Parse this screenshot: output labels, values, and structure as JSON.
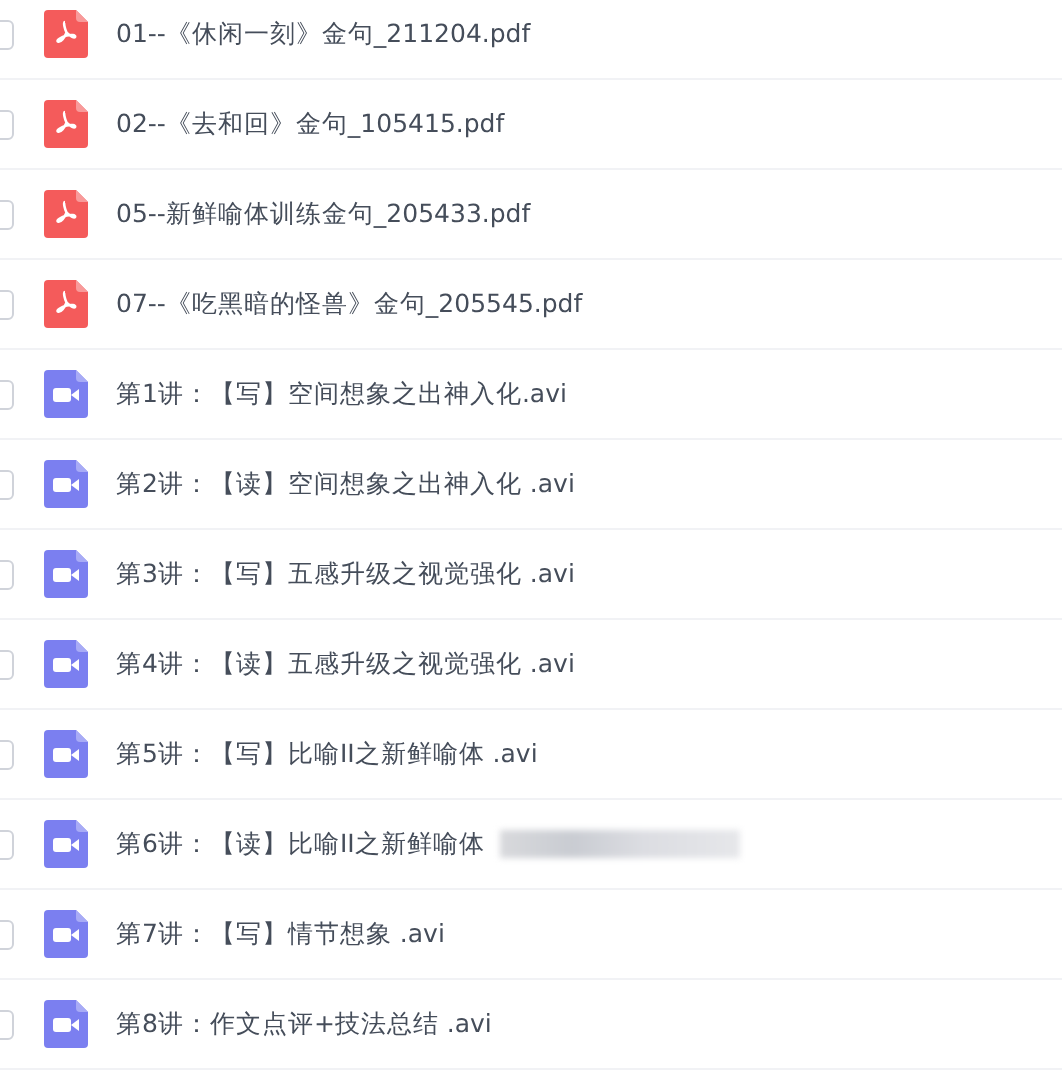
{
  "files": [
    {
      "kind": "pdf",
      "name": "01--《休闲一刻》金句_211204.pdf",
      "checked": false
    },
    {
      "kind": "pdf",
      "name": "02--《去和回》金句_105415.pdf",
      "checked": false
    },
    {
      "kind": "pdf",
      "name": "05--新鲜喻体训练金句_205433.pdf",
      "checked": false
    },
    {
      "kind": "pdf",
      "name": "07--《吃黑暗的怪兽》金句_205545.pdf",
      "checked": false
    },
    {
      "kind": "video",
      "name": "第1讲：【写】空间想象之出神入化.avi",
      "checked": false
    },
    {
      "kind": "video",
      "name": "第2讲：【读】空间想象之出神入化 .avi",
      "checked": false
    },
    {
      "kind": "video",
      "name": "第3讲：【写】五感升级之视觉强化 .avi",
      "checked": false
    },
    {
      "kind": "video",
      "name": "第4讲：【读】五感升级之视觉强化 .avi",
      "checked": false
    },
    {
      "kind": "video",
      "name": "第5讲：【写】比喻II之新鲜喻体 .avi",
      "checked": false
    },
    {
      "kind": "video",
      "name": "第6讲：【读】比喻II之新鲜喻体",
      "checked": false,
      "redacted": true
    },
    {
      "kind": "video",
      "name": "第7讲：【写】情节想象 .avi",
      "checked": false
    },
    {
      "kind": "video",
      "name": "第8讲：作文点评+技法总结 .avi",
      "checked": false
    }
  ]
}
